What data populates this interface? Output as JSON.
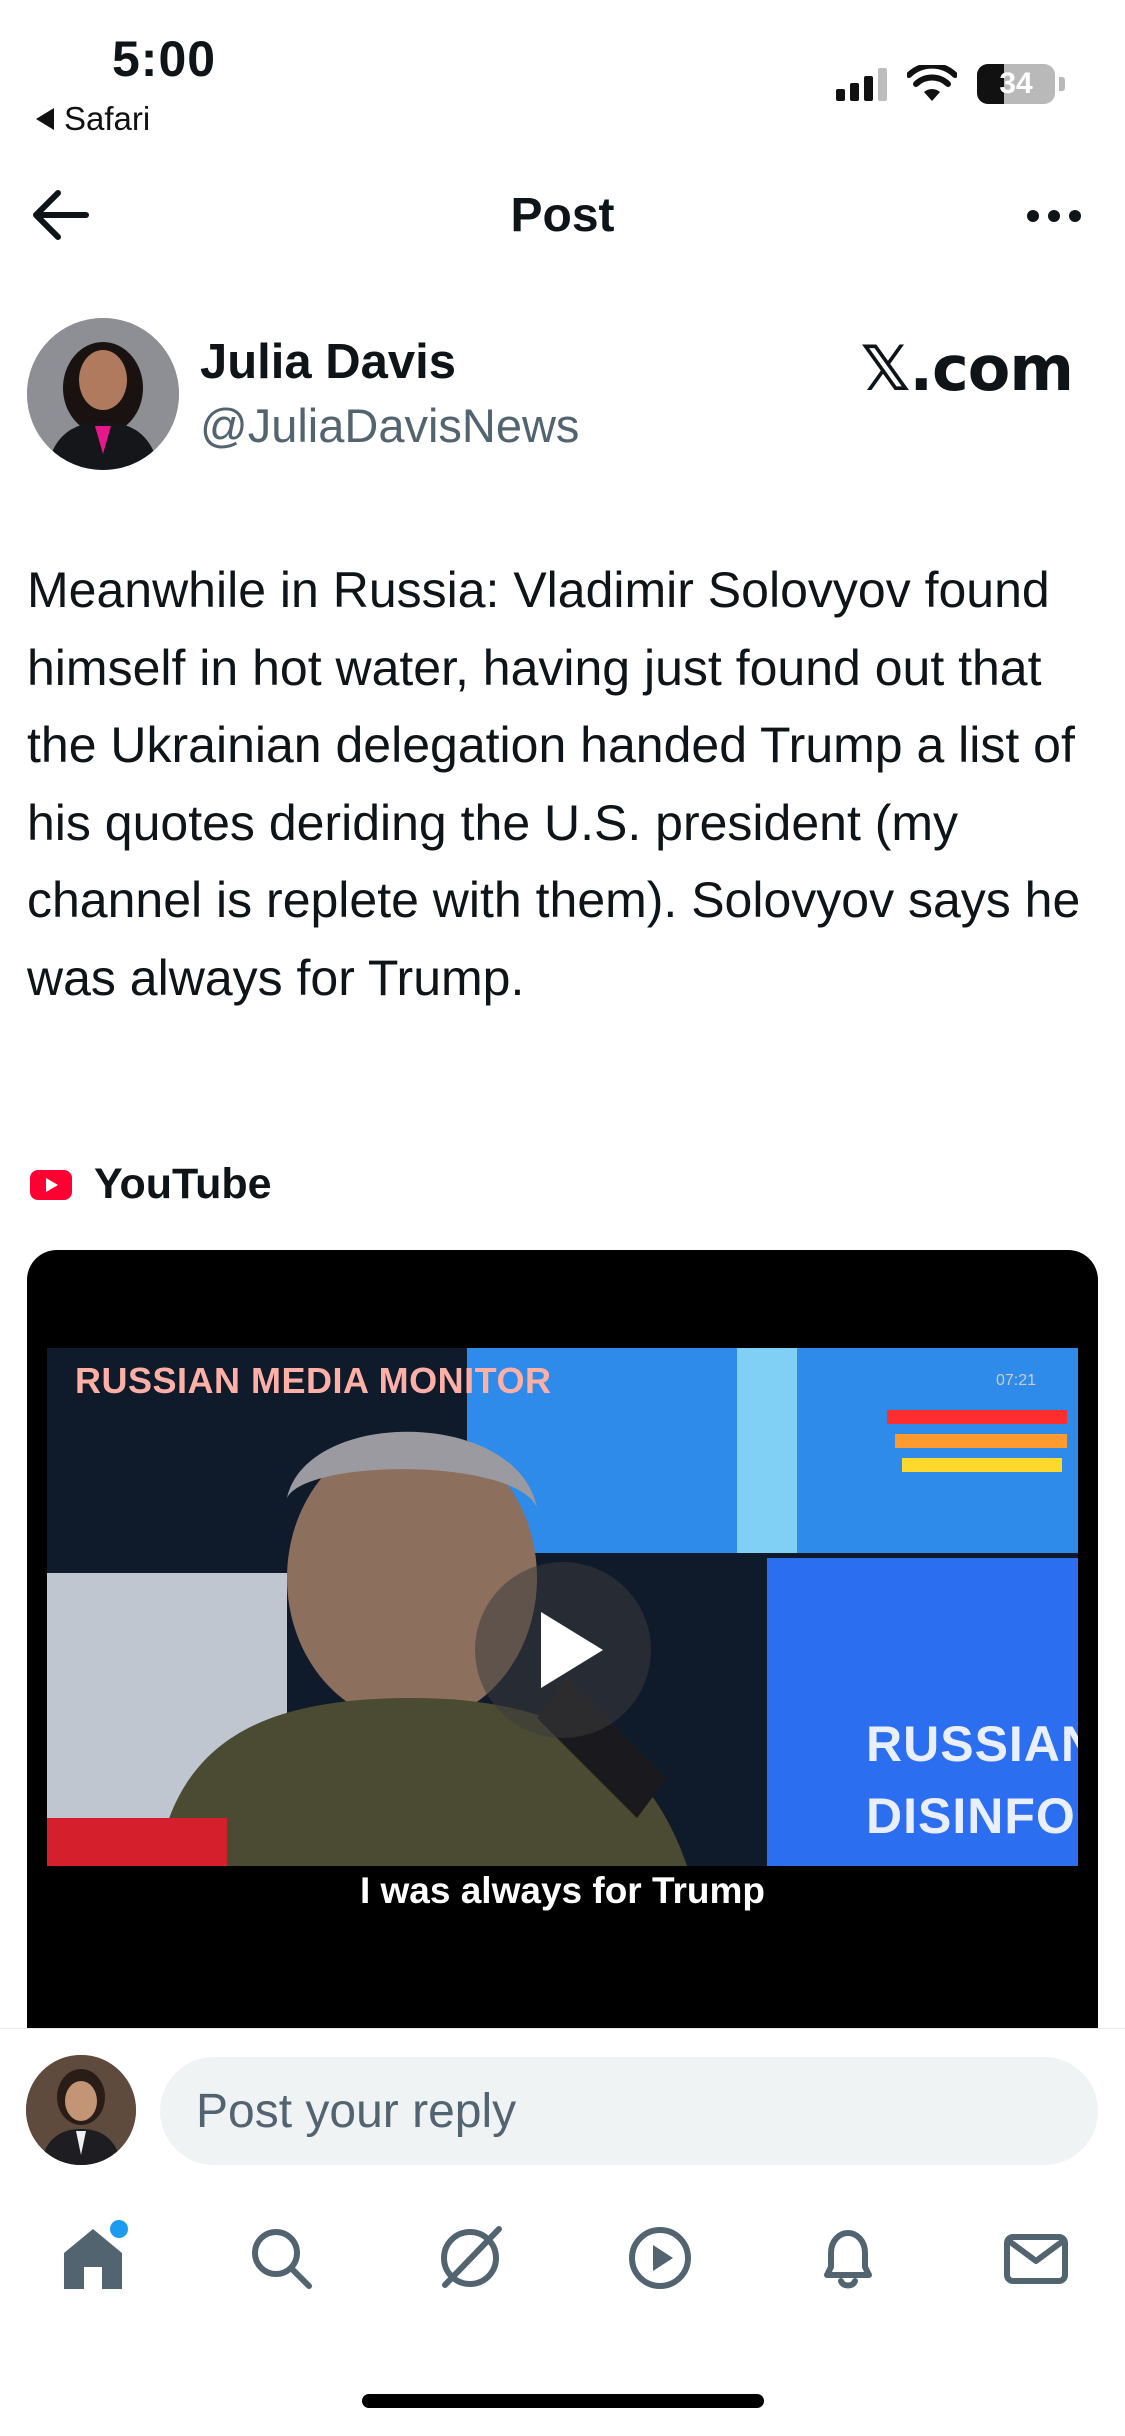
{
  "status_bar": {
    "time": "5:00",
    "back_app": "Safari",
    "battery_level": "34"
  },
  "header": {
    "title": "Post"
  },
  "author": {
    "name": "Julia Davis",
    "handle": "@JuliaDavisNews",
    "watermark": "𝕏.com"
  },
  "post": {
    "text": "Meanwhile in Russia: Vladimir Solovyov found himself in hot water, having just found out that the Ukrainian delegation handed Trump a list of his quotes deriding the U.S. president (my channel is replete with them). Solovyov says he was always for Trump."
  },
  "media": {
    "source": "YouTube",
    "overlay_title": "RUSSIAN MEDIA MONITOR",
    "overlay_clock": "07:21",
    "overlay_brand": "RUSSIAN DISINFO",
    "caption": "I was always for Trump"
  },
  "reply": {
    "placeholder": "Post your reply"
  },
  "tabs": [
    "home-icon",
    "search-icon",
    "grok-icon",
    "video-icon",
    "notifications-icon",
    "messages-icon"
  ],
  "colors": {
    "accent": "#1d9bf0",
    "text": "#0f1419",
    "secondary": "#536471",
    "youtube": "#ff0033"
  }
}
